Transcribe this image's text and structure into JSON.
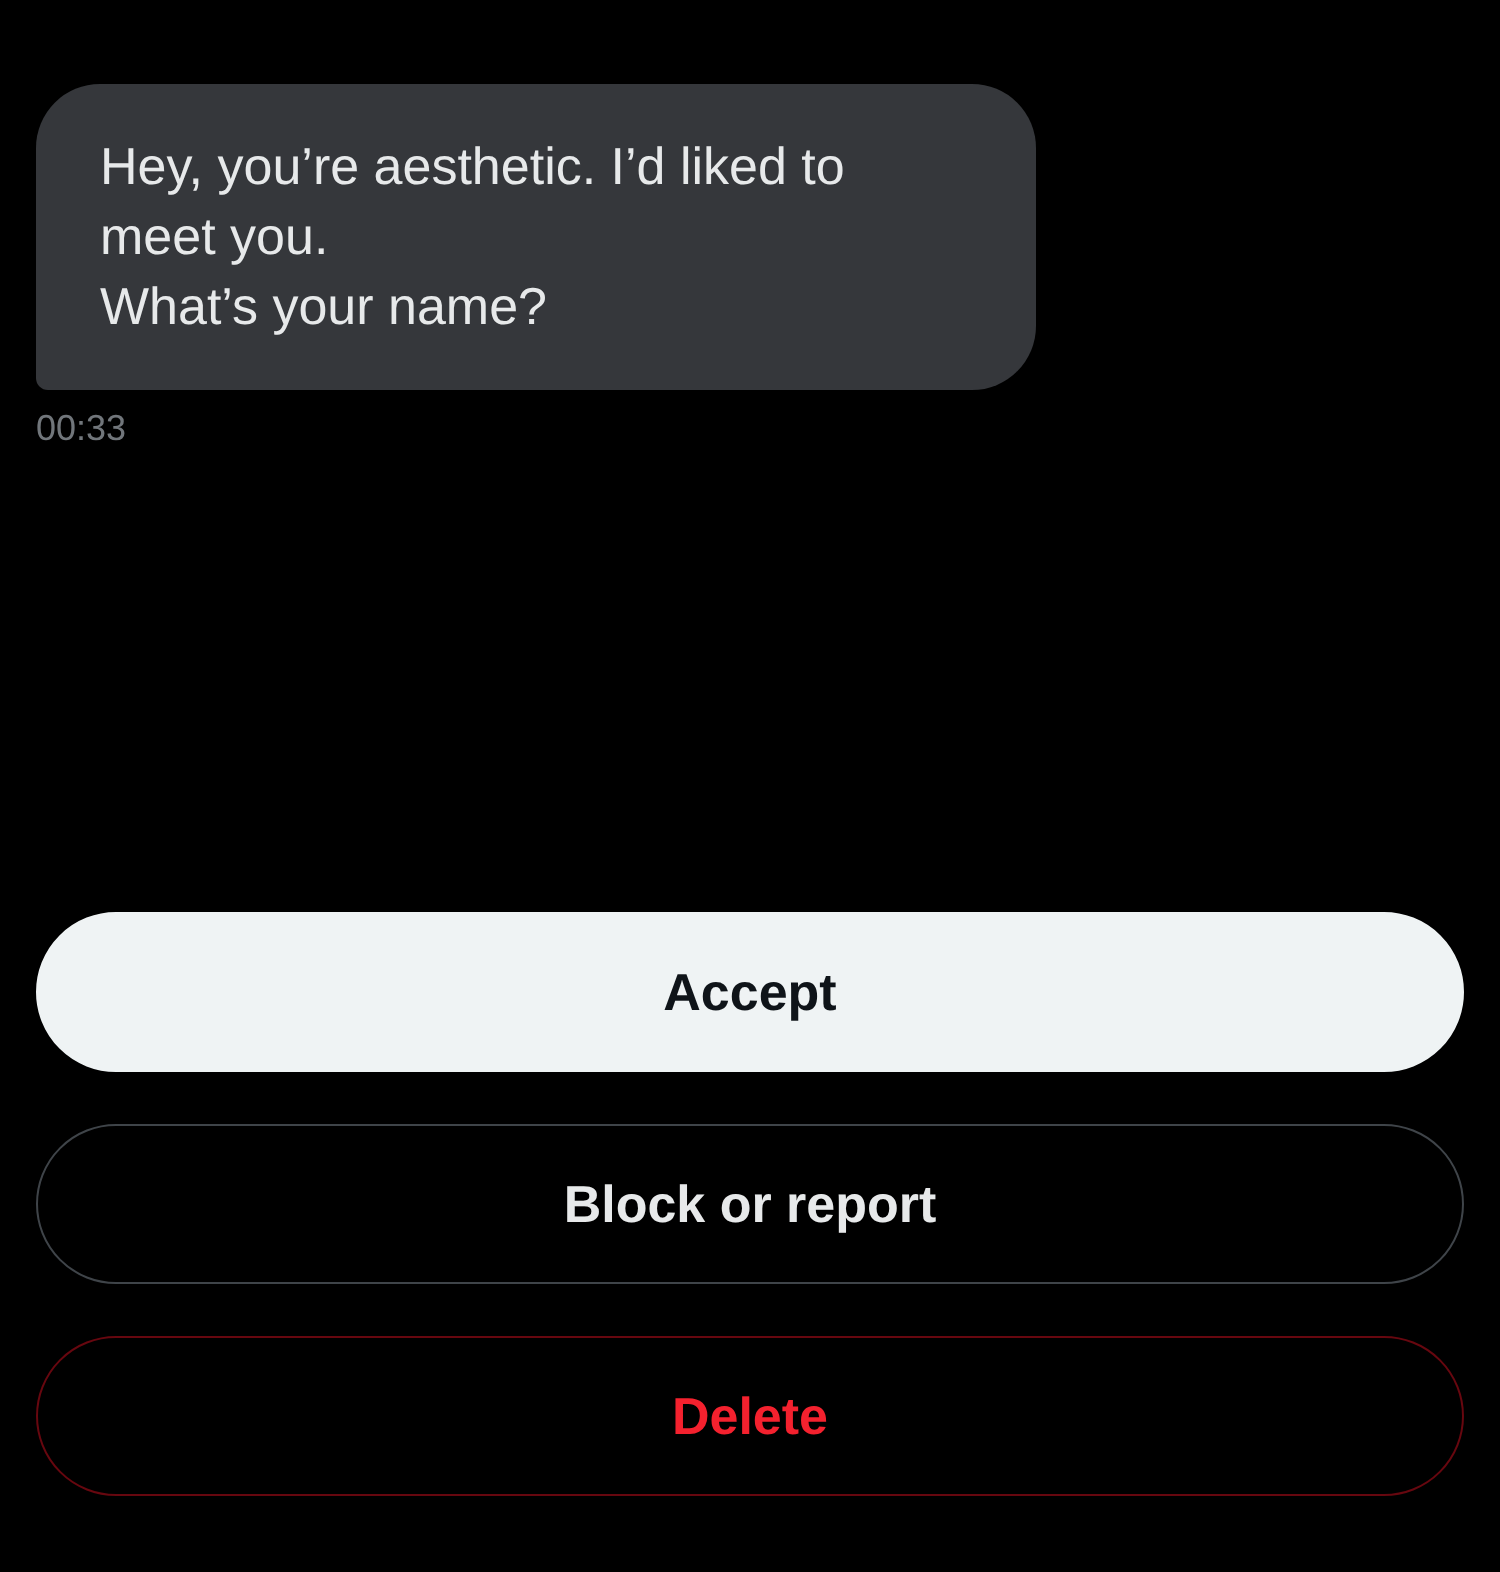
{
  "message": {
    "text": "Hey, you’re aesthetic. I’d liked to meet you.\nWhat’s your name?",
    "time": "00:33"
  },
  "buttons": [
    {
      "label": "Accept",
      "kind": "primary"
    },
    {
      "label": "Block or report",
      "kind": "outline"
    },
    {
      "label": "Delete",
      "kind": "danger"
    }
  ]
}
